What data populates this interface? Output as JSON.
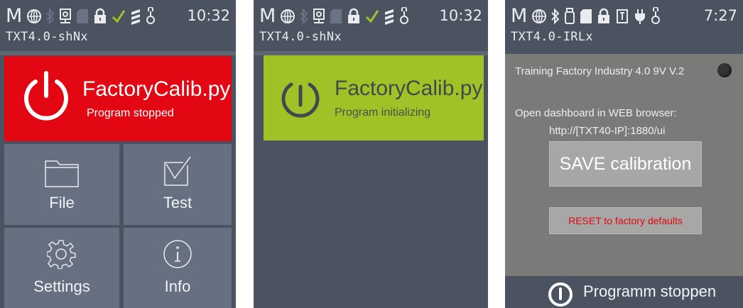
{
  "screens": [
    {
      "status": {
        "mode_letter": "M",
        "clock": "10:32",
        "device": "TXT4.0-shNx"
      },
      "program": {
        "name": "FactoryCalib.py",
        "status": "Program stopped",
        "color": "#e30613"
      },
      "tiles": [
        {
          "label": "File",
          "icon": "folder-icon"
        },
        {
          "label": "Test",
          "icon": "checkbox-icon"
        },
        {
          "label": "Settings",
          "icon": "gear-icon"
        },
        {
          "label": "Info",
          "icon": "info-icon"
        }
      ]
    },
    {
      "status": {
        "mode_letter": "M",
        "clock": "10:32",
        "device": "TXT4.0-shNx"
      },
      "program": {
        "name": "FactoryCalib.py",
        "status": "Program initializing",
        "color": "#9fc327"
      }
    },
    {
      "status": {
        "mode_letter": "M",
        "clock": "7:27",
        "device": "TXT4.0-IRLx"
      },
      "app": {
        "title": "Training Factory Industry 4.0 9V V.2",
        "dashboard_line1": "Open dashboard in WEB browser:",
        "dashboard_line2": "http://[TXT40-IP]:1880/ui",
        "save_button": "SAVE calibration",
        "reset_button": "RESET to factory defaults",
        "stop_label": "Programm stoppen"
      }
    }
  ],
  "colors": {
    "background": "#4b5361",
    "tile": "#677080",
    "accent_red": "#e30613",
    "accent_green": "#9fc327"
  }
}
